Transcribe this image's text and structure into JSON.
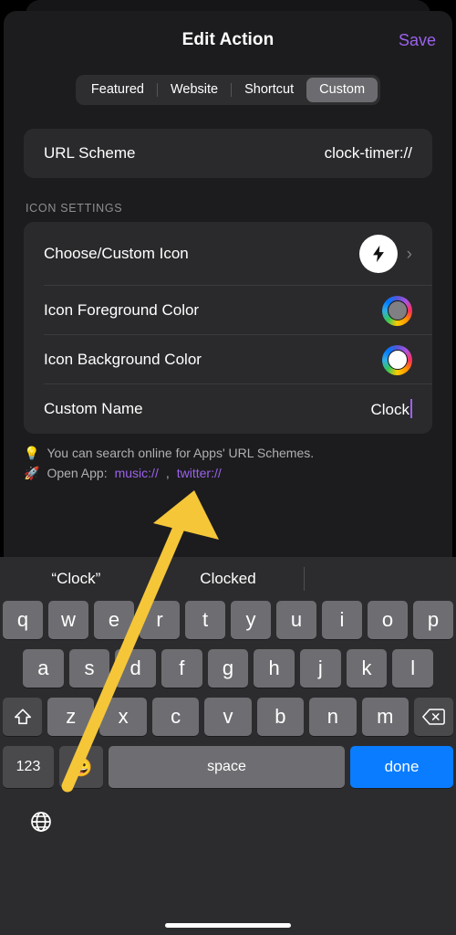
{
  "header": {
    "title": "Edit Action",
    "save_label": "Save"
  },
  "segmented": {
    "options": [
      "Featured",
      "Website",
      "Shortcut",
      "Custom"
    ],
    "selected": "Custom"
  },
  "url_row": {
    "label": "URL Scheme",
    "value": "clock-timer://"
  },
  "icon_settings": {
    "section_title": "ICON SETTINGS",
    "rows": [
      {
        "label": "Choose/Custom Icon",
        "icon": "lightning-bolt-icon",
        "chevron": "›"
      },
      {
        "label": "Icon Foreground Color",
        "swatch": "color-wheel-icon",
        "swatch_center": "#808084"
      },
      {
        "label": "Icon Background Color",
        "swatch": "color-wheel-icon",
        "swatch_center": "#ffffff"
      },
      {
        "label": "Custom Name",
        "value": "Clock"
      }
    ]
  },
  "hints": [
    {
      "emoji": "💡",
      "text": "You can search online for Apps' URL Schemes."
    },
    {
      "emoji": "🚀",
      "prefix": "Open App:",
      "link1": "music://",
      "separator": ",",
      "link2": "twitter://"
    }
  ],
  "keyboard": {
    "suggestions": [
      "“Clock”",
      "Clocked"
    ],
    "row1": [
      "q",
      "w",
      "e",
      "r",
      "t",
      "y",
      "u",
      "i",
      "o",
      "p"
    ],
    "row2": [
      "a",
      "s",
      "d",
      "f",
      "g",
      "h",
      "j",
      "k",
      "l"
    ],
    "row3": [
      "z",
      "x",
      "c",
      "v",
      "b",
      "n",
      "m"
    ],
    "shift_label": "⇧",
    "backspace_label": "⌫",
    "numbers_label": "123",
    "emoji_label": "😀",
    "space_label": "space",
    "done_label": "done",
    "globe_label": "🌐"
  },
  "colors": {
    "accent_purple": "#9b62ec",
    "done_blue": "#0a7cff",
    "annotation_yellow": "#f5c638",
    "sheet_bg": "#1c1c1e",
    "card_bg": "#2a2a2c",
    "key_bg": "#6e6e72"
  }
}
